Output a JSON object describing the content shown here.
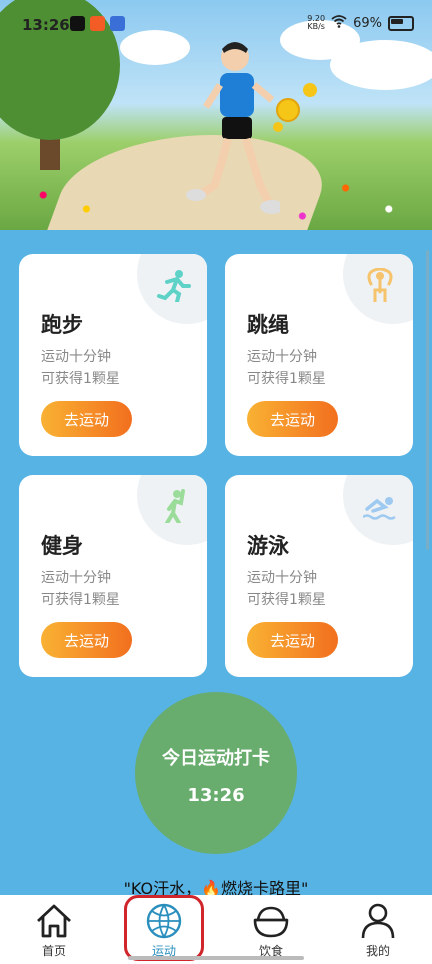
{
  "status_bar": {
    "time": "13:26",
    "net_speed": "9.20",
    "net_unit": "KB/s",
    "battery": "69%"
  },
  "cards": [
    {
      "title": "跑步",
      "desc_line1": "运动十分钟",
      "desc_line2": "可获得1颗星",
      "button": "去运动",
      "icon": "running-icon",
      "icon_color": "#5fd2c8"
    },
    {
      "title": "跳绳",
      "desc_line1": "运动十分钟",
      "desc_line2": "可获得1颗星",
      "button": "去运动",
      "icon": "jump-rope-icon",
      "icon_color": "#f5c36b"
    },
    {
      "title": "健身",
      "desc_line1": "运动十分钟",
      "desc_line2": "可获得1颗星",
      "button": "去运动",
      "icon": "fitness-icon",
      "icon_color": "#9bdc9b"
    },
    {
      "title": "游泳",
      "desc_line1": "运动十分钟",
      "desc_line2": "可获得1颗星",
      "button": "去运动",
      "icon": "swimming-icon",
      "icon_color": "#9ec9f0"
    }
  ],
  "checkin": {
    "label": "今日运动打卡",
    "time": "13:26"
  },
  "slogan": "\"KO汗水，🔥燃烧卡路里\"",
  "nav": [
    {
      "label": "首页",
      "icon": "home-icon"
    },
    {
      "label": "运动",
      "icon": "basketball-icon",
      "active": true
    },
    {
      "label": "饮食",
      "icon": "bowl-icon"
    },
    {
      "label": "我的",
      "icon": "person-icon"
    }
  ],
  "colors": {
    "background": "#57b3e4",
    "button_start": "#f9b233",
    "button_end": "#f26f1e",
    "checkin": "#68ac6e",
    "active_nav": "#2a8fbd"
  }
}
